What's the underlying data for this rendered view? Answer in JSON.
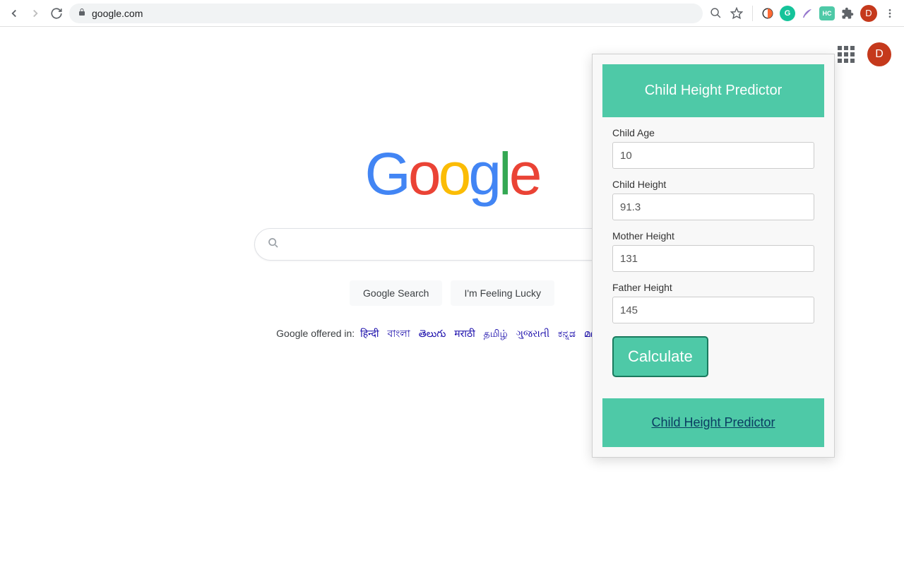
{
  "browser": {
    "url": "google.com",
    "avatar_letter": "D",
    "extensions": {
      "hc_label": "HC"
    }
  },
  "google": {
    "logo_letters": [
      "G",
      "o",
      "o",
      "g",
      "l",
      "e"
    ],
    "search_button": "Google Search",
    "lucky_button": "I'm Feeling Lucky",
    "offered_prefix": "Google offered in:",
    "languages": [
      "हिन्दी",
      "বাংলা",
      "తెలుగు",
      "मराठी",
      "தமிழ்",
      "ગુજરાતી",
      "ಕನ್ನಡ",
      "മലയാളം"
    ],
    "avatar_letter": "D"
  },
  "popup": {
    "title": "Child Height Predictor",
    "fields": {
      "child_age": {
        "label": "Child Age",
        "value": "10"
      },
      "child_height": {
        "label": "Child Height",
        "value": "91.3"
      },
      "mother_height": {
        "label": "Mother Height",
        "value": "131"
      },
      "father_height": {
        "label": "Father Height",
        "value": "145"
      }
    },
    "calculate_label": "Calculate",
    "footer_link": "Child Height Predictor"
  }
}
